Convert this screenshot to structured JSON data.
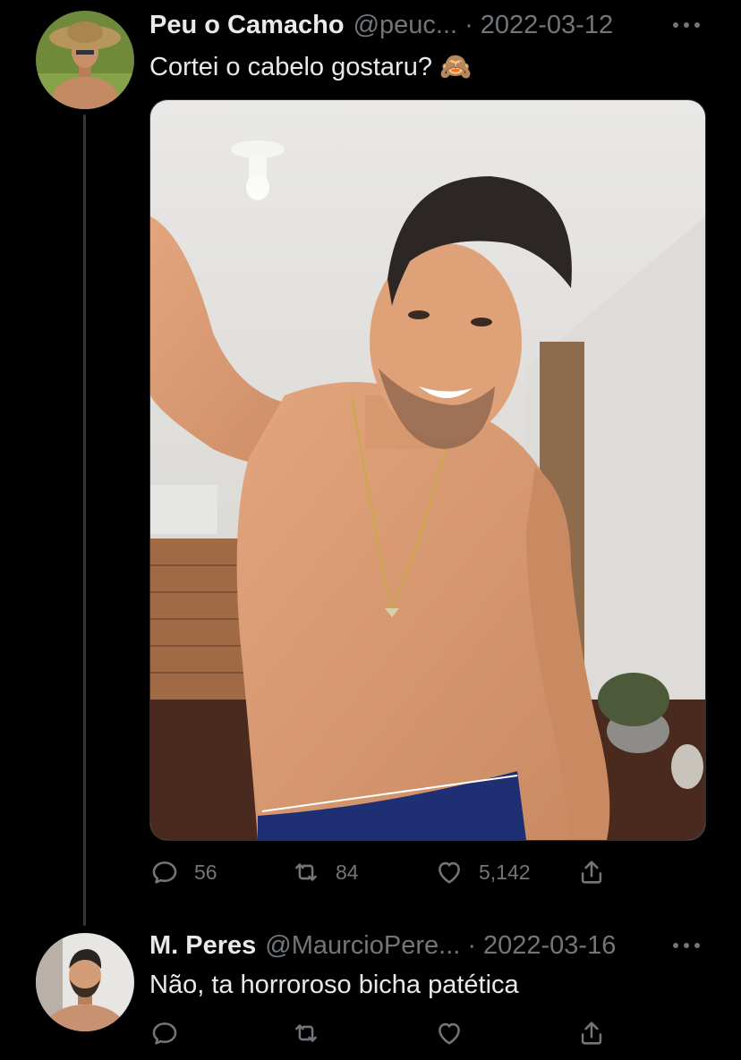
{
  "tweets": [
    {
      "author_name": "Peu o Camacho",
      "handle": "@peuc...",
      "separator": "·",
      "date": "2022-03-12",
      "text": "Cortei o cabelo gostaru? 🙈",
      "replies": "56",
      "retweets": "84",
      "likes": "5,142"
    },
    {
      "author_name": "M. Peres",
      "handle": "@MaurcioPere...",
      "separator": "·",
      "date": "2022-03-16",
      "text": "Não, ta horroroso bicha patética"
    }
  ],
  "icons": {
    "reply": "reply-icon",
    "retweet": "retweet-icon",
    "like": "heart-icon",
    "share": "share-icon",
    "more": "more-icon"
  },
  "colors": {
    "background": "#000000",
    "text_primary": "#e7e9ea",
    "text_secondary": "#71767b",
    "thread_line": "#333639"
  }
}
